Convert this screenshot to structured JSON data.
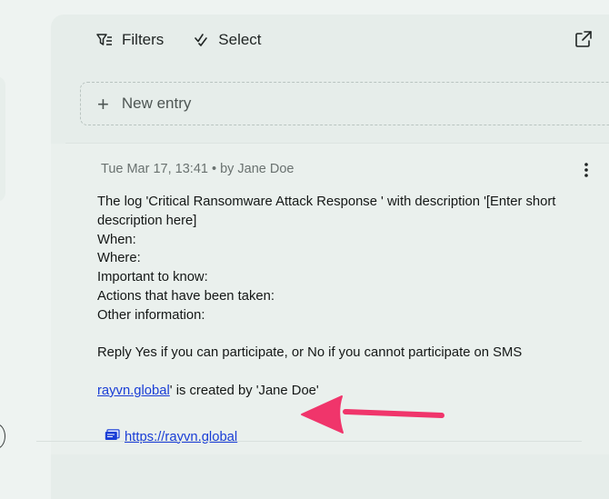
{
  "toolbar": {
    "filters_label": "Filters",
    "select_label": "Select"
  },
  "new_entry": {
    "label": "New entry"
  },
  "entry": {
    "meta": "Tue Mar 17, 13:41 • by Jane Doe",
    "lines": [
      "The log 'Critical Ransomware Attack Response ' with description '[Enter short",
      "description here]",
      "When:",
      "Where:",
      "Important to know:",
      "Actions that have been taken:",
      "Other information:"
    ],
    "reply_line": "Reply Yes if you can participate, or No if you cannot participate on SMS",
    "created_link": "rayvn.global",
    "created_suffix": "' is created by 'Jane Doe'",
    "attachment_link": "https://rayvn.global"
  },
  "colors": {
    "link": "#1a3ed6",
    "annotation_arrow": "#f0356b",
    "panel_background": "#e6edea"
  },
  "icons": {
    "filters": "filter-lines-icon",
    "select": "check-double-icon",
    "external": "external-link-icon",
    "more": "kebab-menu-icon",
    "attachment": "link-card-icon"
  }
}
